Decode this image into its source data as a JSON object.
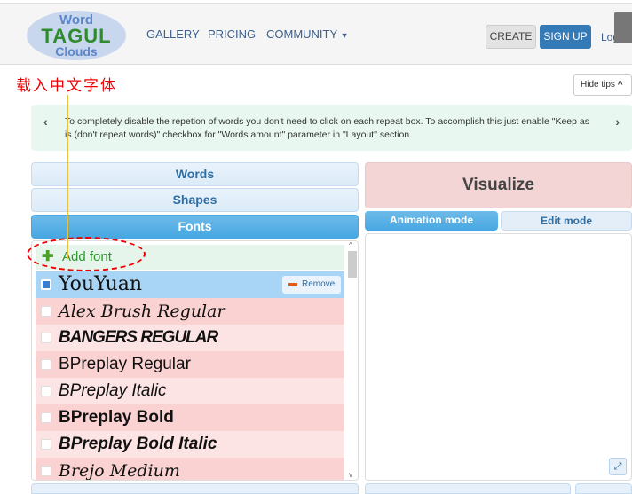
{
  "nav": {
    "logo": [
      "Word",
      "TAGUL",
      "Clouds"
    ],
    "links": [
      "GALLERY",
      "PRICING",
      "COMMUNITY"
    ],
    "create": "CREATE",
    "signup": "SIGN UP",
    "login": "Login"
  },
  "annotation": {
    "text": "载入中文字体",
    "color": "#ee0000"
  },
  "tips": {
    "hide_label": "Hide tips",
    "text": "To completely disable the repetion of words you don't need to click on each repeat box. To accomplish this just enable \"Keep as is (don't repeat words)\" checkbox for \"Words amount\" parameter in \"Layout\" section."
  },
  "sections": [
    "Words",
    "Shapes",
    "Fonts"
  ],
  "visualize": "Visualize",
  "modes": [
    "Animation mode",
    "Edit mode"
  ],
  "fonts": {
    "add_label": "Add font",
    "remove_label": "Remove",
    "items": [
      {
        "name": "YouYuan",
        "checked": true
      },
      {
        "name": "Alex Brush Regular",
        "checked": false
      },
      {
        "name": "BANGERS REGULAR",
        "checked": false
      },
      {
        "name": "BPreplay Regular",
        "checked": false
      },
      {
        "name": "BPreplay Italic",
        "checked": false
      },
      {
        "name": "BPreplay Bold",
        "checked": false
      },
      {
        "name": "BPreplay Bold Italic",
        "checked": false
      },
      {
        "name": "Brejo Medium",
        "checked": false
      }
    ]
  }
}
